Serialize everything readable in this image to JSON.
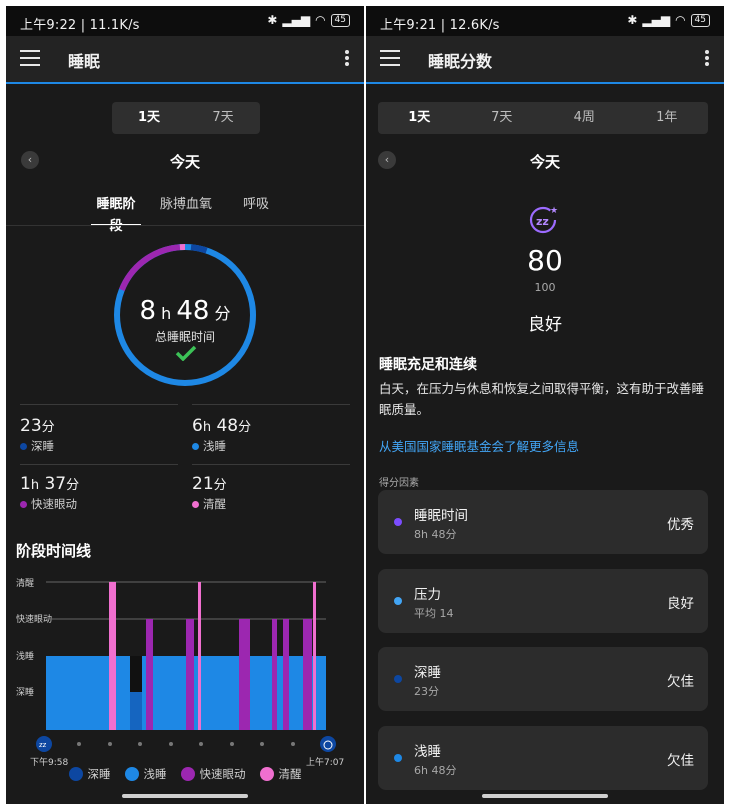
{
  "left": {
    "status": {
      "text": "上午9:22 | 11.1K/s",
      "battery": "45"
    },
    "appbar": {
      "title": "睡眠"
    },
    "range_tabs": [
      "1天",
      "7天"
    ],
    "selected_range": "1天",
    "day_title": "今天",
    "sub_tabs": [
      "睡眠阶段",
      "脉搏血氧",
      "呼吸"
    ],
    "ring": {
      "hours": "8",
      "h_unit": "h",
      "minutes": "48",
      "m_unit": "分",
      "label": "总睡眠时间"
    },
    "stats": [
      {
        "value": "23",
        "unit": "分",
        "label": "深睡",
        "color": "#0d47a1"
      },
      {
        "value": "6",
        "unit_h": "h",
        "value2": "48",
        "unit": "分",
        "label": "浅睡",
        "color": "#1e88e5"
      },
      {
        "value": "1",
        "unit_h": "h",
        "value2": "37",
        "unit": "分",
        "label": "快速眼动",
        "color": "#9c27b0"
      },
      {
        "value": "21",
        "unit": "分",
        "label": "清醒",
        "color": "#f06fcf"
      }
    ],
    "timeline": {
      "title": "阶段时间线",
      "y_labels": [
        "清醒",
        "快速眼动",
        "浅睡",
        "深睡"
      ],
      "start_time": "下午9:58",
      "end_time": "上午7:07"
    },
    "legend": [
      {
        "label": "深睡",
        "color": "#0d47a1"
      },
      {
        "label": "浅睡",
        "color": "#1e88e5"
      },
      {
        "label": "快速眼动",
        "color": "#9c27b0"
      },
      {
        "label": "清醒",
        "color": "#f06fcf"
      }
    ]
  },
  "right": {
    "status": {
      "text": "上午9:21 | 12.6K/s",
      "battery": "45"
    },
    "appbar": {
      "title": "睡眠分数"
    },
    "range_tabs": [
      "1天",
      "7天",
      "4周",
      "1年"
    ],
    "selected_range": "1天",
    "day_title": "今天",
    "score": {
      "value": "80",
      "max": "100",
      "rating": "良好"
    },
    "summary_title": "睡眠充足和连续",
    "summary_text": "白天，在压力与休息和恢复之间取得平衡，这有助于改善睡眠质量。",
    "link_text": "从美国国家睡眠基金会了解更多信息",
    "factors_title": "得分因素",
    "factors": [
      {
        "name": "睡眠时间",
        "sub": "8h 48分",
        "value": "优秀",
        "color": "#7c4dff"
      },
      {
        "name": "压力",
        "sub": "平均 14",
        "value": "良好",
        "color": "#42a5f5"
      },
      {
        "name": "深睡",
        "sub": "23分",
        "value": "欠佳",
        "color": "#0d47a1"
      },
      {
        "name": "浅睡",
        "sub": "6h 48分",
        "value": "欠佳",
        "color": "#1e88e5"
      }
    ]
  }
}
